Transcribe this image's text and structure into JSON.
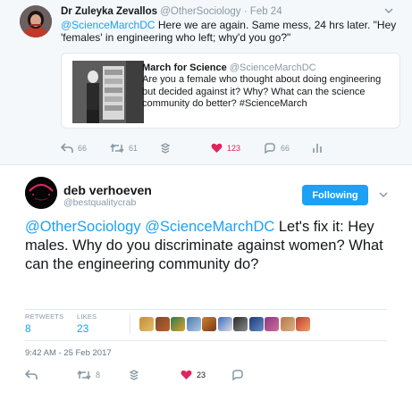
{
  "parent_tweet": {
    "author_name": "Dr Zuleyka Zevallos",
    "author_handle": "@OtherSociology",
    "separator": "·",
    "date": "Feb 24",
    "text_mention": "@ScienceMarchDC",
    "text_rest": " Here we are again. Same mess, 24 hrs later. \"Hey 'females' in engineering who left; why'd you go?\"",
    "quoted": {
      "author_name": "March for Science",
      "author_handle": "@ScienceMarchDC",
      "text": "Are you a female who thought about doing engineering but decided against it? Why? What can the science community do better? #ScienceMarch"
    },
    "actions": {
      "reply_count": "66",
      "retweet_count": "61",
      "like_count": "123",
      "dm_count": "66"
    }
  },
  "main_tweet": {
    "author_name": "deb verhoeven",
    "author_handle": "@bestqualitycrab",
    "follow_label": "Following",
    "mention_1": "@OtherSociology",
    "mention_2": "@ScienceMarchDC",
    "text_rest": " Let's fix it: Hey males. Why do you discriminate against women? What can the engineering community do?",
    "stats": {
      "retweets_label": "RETWEETS",
      "retweets_value": "8",
      "likes_label": "LIKES",
      "likes_value": "23"
    },
    "timestamp": "9:42 AM - 25 Feb 2017",
    "actions": {
      "retweet_count": "8",
      "like_count": "23"
    }
  },
  "colors": {
    "accent": "#1da1f2",
    "like": "#e0245e",
    "muted": "#8899a6"
  },
  "icons": [
    "chevron-down-icon",
    "reply-icon",
    "retweet-icon",
    "stack-icon",
    "heart-icon",
    "dm-icon",
    "analytics-icon"
  ]
}
